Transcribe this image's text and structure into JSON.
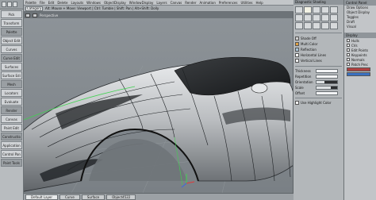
{
  "menubar": {
    "items": [
      "Palette",
      "File",
      "Edit",
      "Delete",
      "Layouts",
      "Windows",
      "ObjectDisplay",
      "WindowDisplay",
      "Layers",
      "Canvas",
      "Render",
      "Animation",
      "Preferences",
      "Utilities",
      "Help"
    ]
  },
  "titlestrip": {
    "category": "Category",
    "info": "Alt: Mouse + Move: Viewport  |  Ctrl: Tumble  |  Shift: Pan  |  Alt+Shift: Dolly"
  },
  "viewport": {
    "name": "Perspective"
  },
  "shelf": {
    "items": [
      {
        "label": "Pick",
        "type": "text"
      },
      {
        "label": "Transform",
        "type": "text"
      },
      {
        "label": "Palette",
        "type": "text"
      },
      {
        "label": "Object Edit",
        "type": "text"
      },
      {
        "label": "Curves",
        "type": "text"
      },
      {
        "label": "Curve Edit",
        "type": "text"
      },
      {
        "label": "Surfaces",
        "type": "text"
      },
      {
        "label": "Surface Edit",
        "type": "text"
      },
      {
        "label": "Mesh",
        "type": "text"
      },
      {
        "label": "Locators",
        "type": "text"
      },
      {
        "label": "Evaluate",
        "type": "text"
      },
      {
        "label": "Render",
        "type": "text"
      },
      {
        "label": "Canvas",
        "type": "text"
      },
      {
        "label": "Paint Edit",
        "type": "text"
      },
      {
        "label": "Construction",
        "type": "text"
      },
      {
        "label": "Application",
        "type": "text"
      },
      {
        "label": "Control Panel",
        "type": "text"
      },
      {
        "label": "Paint Tools",
        "type": "text"
      }
    ]
  },
  "rightpanel": {
    "title": "Diagnostic Shading",
    "tools": [
      "shade-off",
      "multi-color",
      "reflection",
      "zebra",
      "curvature",
      "iso-angle",
      "horizontal",
      "draft",
      "surface-eval",
      "light",
      "environment",
      "texture",
      "on-off",
      "deviation",
      "gaussian"
    ],
    "list": [
      {
        "label": "Shade Off",
        "color": "#d0d0d0"
      },
      {
        "label": "Multi Color",
        "color": "#e0a040"
      },
      {
        "label": "Reflection",
        "color": "#a8c4d8"
      },
      {
        "label": "Horizontal Lines",
        "color": "#ffffff"
      },
      {
        "label": "Vertical Lines",
        "color": "#f0f0f0"
      }
    ],
    "fields": [
      {
        "label": "Thickness",
        "kind": "value"
      },
      {
        "label": "Repetition",
        "kind": "value"
      },
      {
        "label": "Orientation",
        "kind": "slider",
        "level": 0.4
      },
      {
        "label": "Scale",
        "kind": "slider",
        "level": 0.7
      },
      {
        "label": "Offset",
        "kind": "value"
      }
    ],
    "footer": "Use Highlight Color"
  },
  "farright": {
    "title": "Control Panel",
    "items": [
      "Draw Options",
      "Object Display",
      "Toggles",
      "Draft",
      "Visual"
    ],
    "section": "Display",
    "checks": [
      "Hulls",
      "CVs",
      "Edit Points",
      "Keypoints",
      "Normals",
      "Patch Prec"
    ],
    "colors": {
      "swatch_a": "#b04040",
      "swatch_b": "#3a70c0"
    }
  },
  "bottombar": {
    "tabs": [
      "Default Layer",
      "Curve",
      "Surface",
      "Object4522"
    ],
    "active_index": 0
  },
  "accent": "#ffd400"
}
